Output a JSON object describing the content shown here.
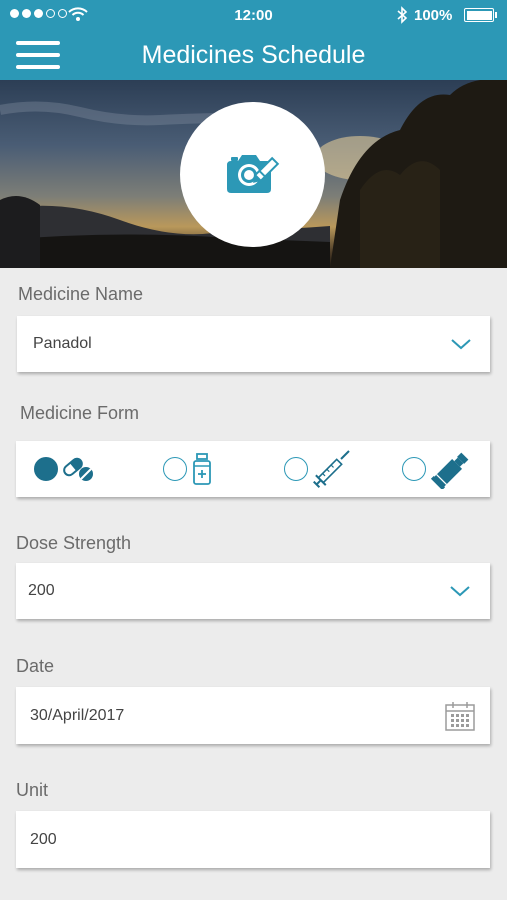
{
  "status_bar": {
    "time": "12:00",
    "battery": "100%"
  },
  "app_bar": {
    "title": "Medicines Schedule"
  },
  "colors": {
    "accent": "#2c98b6",
    "icon_dark": "#1d6f8c",
    "background": "#ececec"
  },
  "form": {
    "medicine_name": {
      "label": "Medicine Name",
      "value": "Panadol"
    },
    "medicine_form": {
      "label": "Medicine Form",
      "options": [
        {
          "icon": "pills-icon",
          "selected": true
        },
        {
          "icon": "bottle-icon",
          "selected": false
        },
        {
          "icon": "syringe-icon",
          "selected": false
        },
        {
          "icon": "ointment-tube-icon",
          "selected": false
        }
      ]
    },
    "dose_strength": {
      "label": "Dose Strength",
      "value": "200"
    },
    "date": {
      "label": "Date",
      "value": "30/April/2017"
    },
    "unit": {
      "label": "Unit",
      "value": "200"
    }
  }
}
